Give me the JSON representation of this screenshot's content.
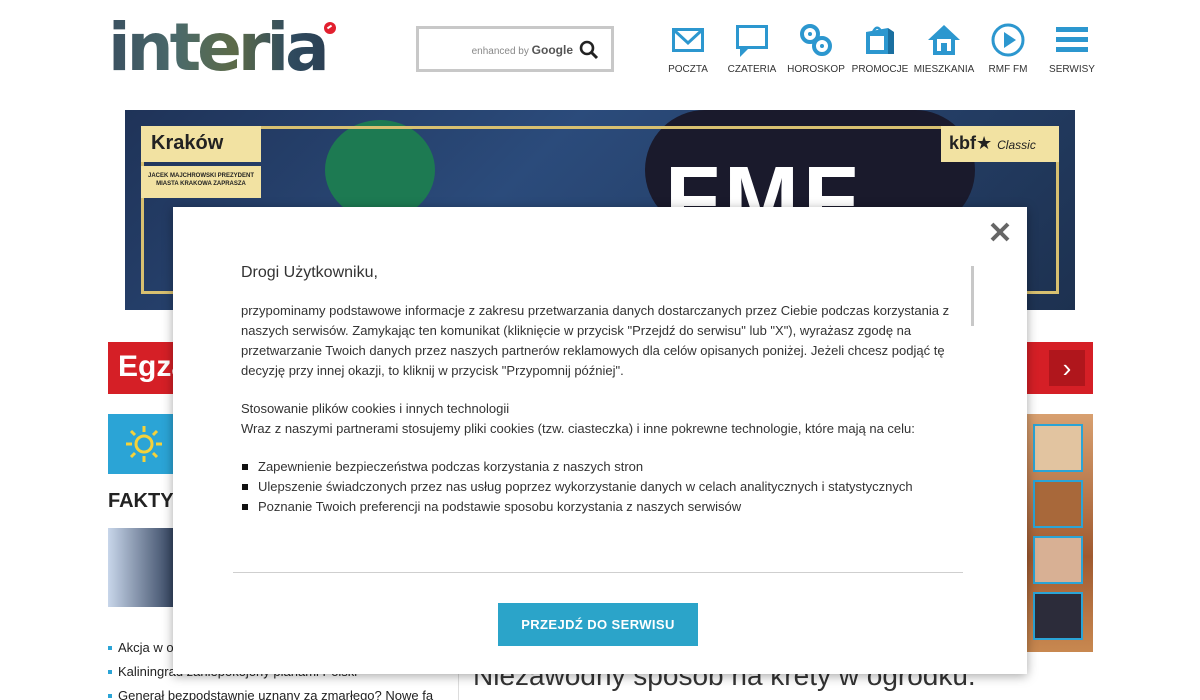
{
  "header": {
    "logo_text": "interia",
    "search": {
      "enhanced_by": "enhanced by",
      "provider": "Google"
    },
    "nav": [
      {
        "label": "POCZTA",
        "icon": "mail-icon"
      },
      {
        "label": "CZATERIA",
        "icon": "chat-icon"
      },
      {
        "label": "HOROSKOP",
        "icon": "horoscope-icon"
      },
      {
        "label": "PROMOCJE",
        "icon": "bag-icon"
      },
      {
        "label": "MIESZKANIA",
        "icon": "house-icon"
      },
      {
        "label": "RMF FM",
        "icon": "play-icon"
      },
      {
        "label": "SERWISY",
        "icon": "menu-icon"
      }
    ]
  },
  "banner": {
    "city": "Kraków",
    "city_sub": "JACEK MAJCHROWSKI PREZYDENT MIASTA KRAKOWA ZAPRASZA",
    "sponsor": "kbf",
    "sponsor_sub": "Classic",
    "headline": "FMF"
  },
  "background": {
    "redbar_text": "Egza",
    "fakty_title": "FAKTY",
    "news": [
      "Akcja w o",
      "Kaliningrad zaniepokojony planami Polski",
      "Generał bezpodstawnie uznany za zmarłego? Nowe fa"
    ],
    "headline": "Niezawodny sposób na krety w ogródku."
  },
  "modal": {
    "greeting": "Drogi Użytkowniku,",
    "intro": "przypominamy podstawowe informacje z zakresu przetwarzania danych dostarczanych przez Ciebie podczas korzystania z naszych serwisów. Zamykając ten komunikat (kliknięcie w przycisk \"Przejdź do serwisu\" lub \"X\"), wyrażasz zgodę na przetwarzanie Twoich danych przez naszych partnerów reklamowych dla celów opisanych poniżej. Jeżeli chcesz podjąć tę decyzję przy innej okazji, to kliknij w przycisk \"Przypomnij później\".",
    "cookies_heading": "Stosowanie plików cookies i innych technologii",
    "cookies_text": "Wraz z naszymi partnerami stosujemy pliki cookies (tzw. ciasteczka) i inne pokrewne technologie, które mają na celu:",
    "bullets": [
      "Zapewnienie bezpieczeństwa podczas korzystania z naszych stron",
      "Ulepszenie świadczonych przez nas usług poprzez wykorzystanie danych w celach analitycznych i statystycznych",
      "Poznanie Twoich preferencji na podstawie sposobu korzystania z naszych serwisów"
    ],
    "button_label": "PRZEJDŹ DO SERWISU"
  },
  "colors": {
    "accent": "#2ba4c9",
    "nav_icon": "#2c97cf",
    "red": "#d51f26"
  }
}
